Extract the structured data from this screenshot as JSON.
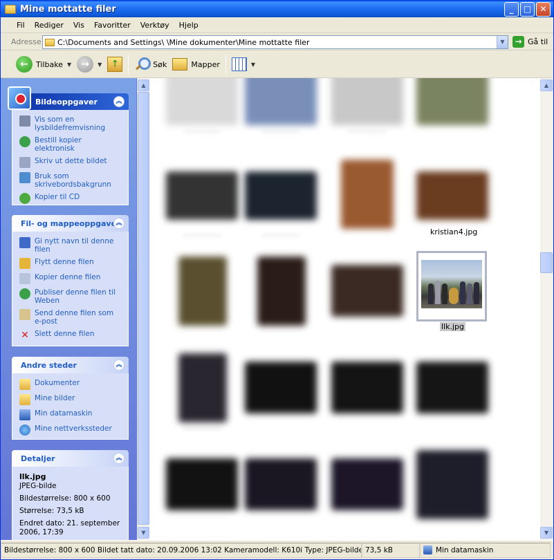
{
  "window": {
    "title": "Mine mottatte filer"
  },
  "menu": [
    "Fil",
    "Rediger",
    "Vis",
    "Favoritter",
    "Verktøy",
    "Hjelp"
  ],
  "address": {
    "label": "Adresse",
    "path": "C:\\Documents and Settings\\      \\Mine dokumenter\\Mine mottatte filer",
    "go_label": "Gå til"
  },
  "toolbar": {
    "back": "Tilbake",
    "search": "Søk",
    "folders": "Mapper"
  },
  "panels": {
    "picture_tasks": {
      "title": "Bildeoppgaver",
      "items": [
        "Vis som en lysbildefremvisning",
        "Bestill kopier elektronisk",
        "Skriv ut dette bildet",
        "Bruk som skrivebordsbakgrunn",
        "Kopier til CD"
      ]
    },
    "file_tasks": {
      "title": "Fil- og mappeoppgaver",
      "items": [
        "Gi nytt navn til denne filen",
        "Flytt denne filen",
        "Kopier denne filen",
        "Publiser denne filen til Weben",
        "Send denne filen som e-post",
        "Slett denne filen"
      ]
    },
    "other_places": {
      "title": "Andre steder",
      "items": [
        "Dokumenter",
        "Mine bilder",
        "Min datamaskin",
        "Mine nettverkssteder"
      ]
    },
    "details": {
      "title": "Detaljer",
      "name": "llk.jpg",
      "type": "JPEG-bilde",
      "dimensions": "Bildestørrelse: 800 x 600",
      "size": "Størrelse: 73,5 kB",
      "modified": "Endret dato: 21. september 2006, 17:39"
    }
  },
  "files": {
    "kristian_caption": "kristian4.jpg",
    "selected_caption": "llk.jpg"
  },
  "status": {
    "main": "Bildestørrelse: 800 x 600 Bildet tatt dato: 20.09.2006 13:02 Kameramodell: K610i Type: JPEG-bilde Størrelse",
    "size": "73,5 kB",
    "zone": "Min datamaskin"
  },
  "colors": {
    "title_blue": "#0c58d6",
    "task_link": "#215dc6",
    "pane_blue": "#6375d6",
    "selection_gray": "#c9c9c9"
  }
}
